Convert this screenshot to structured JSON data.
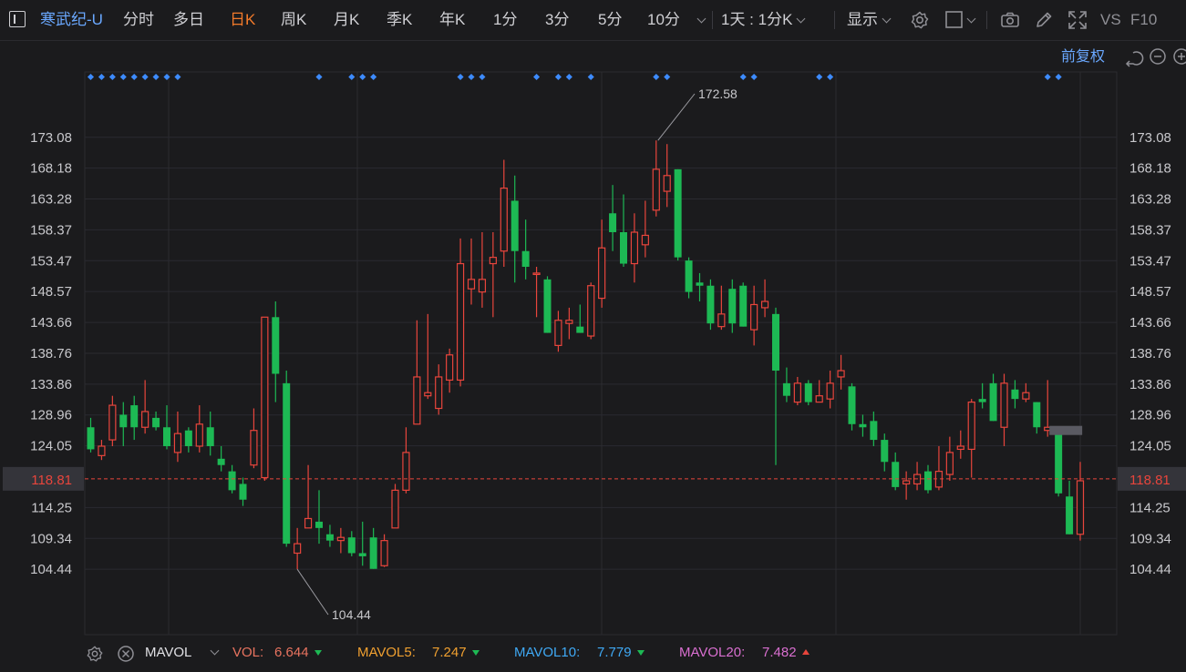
{
  "toolbar": {
    "symbol": "寒武纪-U",
    "periods": [
      "分时",
      "多日",
      "日K",
      "周K",
      "月K",
      "季K",
      "年K",
      "1分",
      "3分",
      "5分",
      "10分"
    ],
    "active_period": "日K",
    "multi_period": "1天 : 1分K",
    "display": "显示",
    "vs": "VS",
    "f10": "F10"
  },
  "adjust_label": "前复权",
  "colors": {
    "up": "#e8453c",
    "down": "#1db954",
    "marker": "#3d8bfd",
    "last_price": "#e8453c",
    "bg": "#1b1b1d"
  },
  "chart_data": {
    "type": "candlestick",
    "y_ticks": [
      173.08,
      168.18,
      163.28,
      158.37,
      153.47,
      148.57,
      143.66,
      138.76,
      133.86,
      128.96,
      124.05,
      114.25,
      109.34,
      104.44
    ],
    "ylim": [
      99.4,
      178.4
    ],
    "last_price": "118.81",
    "high_label": "172.58",
    "low_label": "104.44",
    "grid": true,
    "candles": [
      {
        "o": 127,
        "c": 123.5,
        "h": 128.5,
        "l": 123
      },
      {
        "o": 122.5,
        "c": 124,
        "h": 125,
        "l": 121.8
      },
      {
        "o": 125,
        "c": 130.5,
        "h": 132,
        "l": 124
      },
      {
        "o": 129,
        "c": 127,
        "h": 131,
        "l": 124
      },
      {
        "o": 130.5,
        "c": 127,
        "h": 132,
        "l": 125
      },
      {
        "o": 127,
        "c": 129.5,
        "h": 134.5,
        "l": 126
      },
      {
        "o": 128.5,
        "c": 127,
        "h": 129.5,
        "l": 126.5
      },
      {
        "o": 127,
        "c": 124,
        "h": 130.5,
        "l": 123.5
      },
      {
        "o": 123,
        "c": 126,
        "h": 129.5,
        "l": 121.5
      },
      {
        "o": 126.5,
        "c": 124,
        "h": 127,
        "l": 123
      },
      {
        "o": 124,
        "c": 127.5,
        "h": 130.5,
        "l": 123
      },
      {
        "o": 127,
        "c": 124,
        "h": 129.5,
        "l": 122.5
      },
      {
        "o": 122,
        "c": 121,
        "h": 124,
        "l": 120
      },
      {
        "o": 120,
        "c": 117,
        "h": 121,
        "l": 116.5
      },
      {
        "o": 118,
        "c": 115.5,
        "h": 119,
        "l": 114.5
      },
      {
        "o": 121,
        "c": 126.5,
        "h": 130,
        "l": 120.5
      },
      {
        "o": 119,
        "c": 144.5,
        "h": 144.5,
        "l": 118.5
      },
      {
        "o": 144.5,
        "c": 135.5,
        "h": 147,
        "l": 131
      },
      {
        "o": 134,
        "c": 108.5,
        "h": 136,
        "l": 108
      },
      {
        "o": 107,
        "c": 108.5,
        "h": 111,
        "l": 104.44
      },
      {
        "o": 111,
        "c": 112.5,
        "h": 121,
        "l": 111
      },
      {
        "o": 112,
        "c": 111,
        "h": 117,
        "l": 108.5
      },
      {
        "o": 110,
        "c": 109,
        "h": 111.5,
        "l": 108
      },
      {
        "o": 109,
        "c": 109.5,
        "h": 111,
        "l": 107
      },
      {
        "o": 109.5,
        "c": 107,
        "h": 110.5,
        "l": 106.5
      },
      {
        "o": 107,
        "c": 106.5,
        "h": 112,
        "l": 105
      },
      {
        "o": 109.5,
        "c": 104.5,
        "h": 111,
        "l": 104.5
      },
      {
        "o": 105,
        "c": 109,
        "h": 110,
        "l": 104.8
      },
      {
        "o": 111,
        "c": 117,
        "h": 118,
        "l": 111
      },
      {
        "o": 117,
        "c": 123,
        "h": 127,
        "l": 116.5
      },
      {
        "o": 127.5,
        "c": 135,
        "h": 144,
        "l": 127.5
      },
      {
        "o": 132,
        "c": 132.5,
        "h": 145,
        "l": 131.5
      },
      {
        "o": 130,
        "c": 135,
        "h": 137,
        "l": 129
      },
      {
        "o": 134.5,
        "c": 138.5,
        "h": 139.5,
        "l": 132.5
      },
      {
        "o": 134.5,
        "c": 153,
        "h": 157,
        "l": 133.5
      },
      {
        "o": 149,
        "c": 150.5,
        "h": 157,
        "l": 146.5
      },
      {
        "o": 148.5,
        "c": 150.5,
        "h": 158,
        "l": 146
      },
      {
        "o": 153,
        "c": 154,
        "h": 158,
        "l": 144.5
      },
      {
        "o": 155,
        "c": 165,
        "h": 169.5,
        "l": 152.5
      },
      {
        "o": 163,
        "c": 155,
        "h": 167,
        "l": 150
      },
      {
        "o": 155,
        "c": 152.5,
        "h": 160,
        "l": 150.5
      },
      {
        "o": 151.5,
        "c": 151.5,
        "h": 152.5,
        "l": 144.5
      },
      {
        "o": 150.5,
        "c": 142,
        "h": 151,
        "l": 142
      },
      {
        "o": 140,
        "c": 144,
        "h": 145.5,
        "l": 139
      },
      {
        "o": 143.5,
        "c": 144,
        "h": 146,
        "l": 141
      },
      {
        "o": 143,
        "c": 142,
        "h": 146.5,
        "l": 142
      },
      {
        "o": 141.5,
        "c": 149.5,
        "h": 150,
        "l": 141
      },
      {
        "o": 147.5,
        "c": 155.5,
        "h": 160,
        "l": 146
      },
      {
        "o": 161,
        "c": 158,
        "h": 165.5,
        "l": 155
      },
      {
        "o": 158,
        "c": 153,
        "h": 164,
        "l": 152.5
      },
      {
        "o": 153,
        "c": 158,
        "h": 161,
        "l": 150
      },
      {
        "o": 156,
        "c": 157.5,
        "h": 163,
        "l": 154
      },
      {
        "o": 161.5,
        "c": 168,
        "h": 172.58,
        "l": 160.5
      },
      {
        "o": 164.5,
        "c": 167,
        "h": 172,
        "l": 162
      },
      {
        "o": 168,
        "c": 154,
        "h": 168,
        "l": 153.5
      },
      {
        "o": 153.5,
        "c": 148.5,
        "h": 154,
        "l": 147.5
      },
      {
        "o": 150,
        "c": 149.5,
        "h": 151.5,
        "l": 147
      },
      {
        "o": 149.5,
        "c": 143.5,
        "h": 150.5,
        "l": 142.5
      },
      {
        "o": 143,
        "c": 145,
        "h": 149.5,
        "l": 142.5
      },
      {
        "o": 149,
        "c": 143.5,
        "h": 150.5,
        "l": 142
      },
      {
        "o": 149.5,
        "c": 143,
        "h": 150,
        "l": 143
      },
      {
        "o": 142.5,
        "c": 146.5,
        "h": 149.5,
        "l": 140
      },
      {
        "o": 146,
        "c": 147,
        "h": 150.5,
        "l": 144.5
      },
      {
        "o": 145,
        "c": 136,
        "h": 146,
        "l": 121
      },
      {
        "o": 134,
        "c": 132,
        "h": 136.5,
        "l": 131
      },
      {
        "o": 131,
        "c": 134,
        "h": 135,
        "l": 130.5
      },
      {
        "o": 134,
        "c": 131,
        "h": 134.5,
        "l": 130.5
      },
      {
        "o": 131,
        "c": 132,
        "h": 134.5,
        "l": 131
      },
      {
        "o": 131.5,
        "c": 134,
        "h": 136,
        "l": 130
      },
      {
        "o": 135,
        "c": 136,
        "h": 138.5,
        "l": 133
      },
      {
        "o": 133.5,
        "c": 127.5,
        "h": 134,
        "l": 126.5
      },
      {
        "o": 127.5,
        "c": 127,
        "h": 129,
        "l": 125.5
      },
      {
        "o": 128,
        "c": 125,
        "h": 129.5,
        "l": 124
      },
      {
        "o": 125,
        "c": 121.5,
        "h": 126,
        "l": 120
      },
      {
        "o": 121.5,
        "c": 117.5,
        "h": 123,
        "l": 117
      },
      {
        "o": 118,
        "c": 118.5,
        "h": 120,
        "l": 115.5
      },
      {
        "o": 118,
        "c": 119.5,
        "h": 121.5,
        "l": 117
      },
      {
        "o": 120,
        "c": 117,
        "h": 121,
        "l": 116.5
      },
      {
        "o": 117.5,
        "c": 120,
        "h": 124,
        "l": 117
      },
      {
        "o": 119.5,
        "c": 123,
        "h": 125.5,
        "l": 118.5
      },
      {
        "o": 123.5,
        "c": 124,
        "h": 126.5,
        "l": 122
      },
      {
        "o": 123.5,
        "c": 131,
        "h": 131.5,
        "l": 119
      },
      {
        "o": 131.5,
        "c": 131,
        "h": 134,
        "l": 130
      },
      {
        "o": 134,
        "c": 128,
        "h": 135.5,
        "l": 128
      },
      {
        "o": 127,
        "c": 134,
        "h": 135.5,
        "l": 124
      },
      {
        "o": 133,
        "c": 131.5,
        "h": 134.5,
        "l": 130
      },
      {
        "o": 131.5,
        "c": 132.5,
        "h": 134,
        "l": 131
      },
      {
        "o": 131,
        "c": 127,
        "h": 131,
        "l": 126
      },
      {
        "o": 126.5,
        "c": 127,
        "h": 134.5,
        "l": 125.5
      },
      {
        "o": 126,
        "c": 116.5,
        "h": 127,
        "l": 116
      },
      {
        "o": 116,
        "c": 110,
        "h": 118.5,
        "l": 110
      },
      {
        "o": 110,
        "c": 118.5,
        "h": 121.5,
        "l": 109
      }
    ],
    "markers": [
      0,
      1,
      2,
      3,
      4,
      5,
      6,
      7,
      8,
      21,
      24,
      25,
      26,
      34,
      35,
      36,
      41,
      43,
      44,
      46,
      52,
      53,
      60,
      61,
      67,
      68,
      88,
      89
    ]
  },
  "indicator": {
    "name": "MAVOL",
    "vol_label": "VOL:",
    "vol": "6.644",
    "mavol5_label": "MAVOL5:",
    "mavol5": "7.247",
    "mavol10_label": "MAVOL10:",
    "mavol10": "7.779",
    "mavol20_label": "MAVOL20:",
    "mavol20": "7.482"
  }
}
